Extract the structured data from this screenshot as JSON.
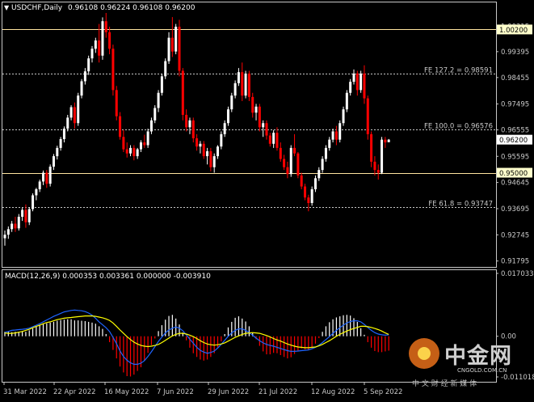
{
  "header": {
    "symbol_timeframe": "USDCHF,Daily",
    "ohlc": "0.96108 0.96224 0.96108 0.96200"
  },
  "price_axis": {
    "ticks": [
      "1.00315",
      "0.99395",
      "0.98455",
      "0.97495",
      "0.96555",
      "0.95595",
      "0.94645",
      "0.93695",
      "0.92745",
      "0.91795"
    ],
    "tick_values": [
      1.00315,
      0.99395,
      0.98455,
      0.97495,
      0.96555,
      0.95595,
      0.94645,
      0.93695,
      0.92745,
      0.91795
    ],
    "range": [
      0.9158,
      1.008
    ],
    "current_price": {
      "label": "0.96200",
      "value": 0.962
    }
  },
  "levels": [
    {
      "label": "1.00200",
      "value": 1.002,
      "style": "solid",
      "color": "#ffe4a0",
      "tagged": true
    },
    {
      "label": "0.95000",
      "value": 0.95,
      "style": "solid",
      "color": "#ffe4a0",
      "tagged": true
    },
    {
      "label": "FE 127.2 = 0.98591",
      "value": 0.98591,
      "style": "dotted",
      "color": "#c8c8c8",
      "tagged": false
    },
    {
      "label": "FE 100.0 = 0.96576",
      "value": 0.96576,
      "style": "dotted",
      "color": "#c8c8c8",
      "tagged": false
    },
    {
      "label": "FE 61.8 = 0.93747",
      "value": 0.93747,
      "style": "dotted",
      "color": "#c8c8c8",
      "tagged": false
    }
  ],
  "date_axis": [
    "31 Mar 2022",
    "22 Apr 2022",
    "16 May 2022",
    "7 Jun 2022",
    "29 Jun 2022",
    "21 Jul 2022",
    "12 Aug 2022",
    "5 Sep 2022"
  ],
  "macd": {
    "title": "MACD(12,26,9) 0.000353 0.003361 0.000000 -0.003910",
    "ticks": [
      "0.017033",
      "0.00",
      "-0.011018"
    ],
    "tick_values": [
      0.017033,
      0,
      -0.011018
    ]
  },
  "watermark": {
    "brand": "中金网",
    "domain": "CNGOLD.COM.CN",
    "slogan": "中 文 财 经 新 媒 体"
  },
  "colors": {
    "bull_candle": "#ffffff",
    "bear_candle": "#ff0000",
    "signal_line": "#ffff00",
    "macd_line": "#1e64ff",
    "level_line": "#ffe4a0",
    "tag_background": "#ffffcc"
  },
  "chart_data": {
    "type": "candlestick",
    "pair": "USDCHF",
    "timeframe": "Daily",
    "ohlc": [
      [
        0.9262,
        0.929,
        0.9235,
        0.9275
      ],
      [
        0.9275,
        0.9305,
        0.926,
        0.9295
      ],
      [
        0.9295,
        0.9325,
        0.9285,
        0.9315
      ],
      [
        0.9315,
        0.934,
        0.9285,
        0.9298
      ],
      [
        0.9298,
        0.935,
        0.929,
        0.934
      ],
      [
        0.934,
        0.9372,
        0.9325,
        0.9365
      ],
      [
        0.9365,
        0.9385,
        0.93,
        0.932
      ],
      [
        0.932,
        0.9375,
        0.931,
        0.9368
      ],
      [
        0.9368,
        0.9425,
        0.936,
        0.9418
      ],
      [
        0.9418,
        0.9445,
        0.94,
        0.944
      ],
      [
        0.944,
        0.9475,
        0.943,
        0.9468
      ],
      [
        0.9468,
        0.9508,
        0.9455,
        0.95
      ],
      [
        0.95,
        0.951,
        0.9445,
        0.946
      ],
      [
        0.946,
        0.953,
        0.945,
        0.9522
      ],
      [
        0.9522,
        0.9568,
        0.951,
        0.956
      ],
      [
        0.956,
        0.9598,
        0.9548,
        0.959
      ],
      [
        0.959,
        0.963,
        0.958,
        0.9622
      ],
      [
        0.9622,
        0.9668,
        0.961,
        0.966
      ],
      [
        0.966,
        0.971,
        0.965,
        0.97
      ],
      [
        0.97,
        0.9745,
        0.969,
        0.9738
      ],
      [
        0.9738,
        0.9755,
        0.966,
        0.968
      ],
      [
        0.968,
        0.979,
        0.967,
        0.978
      ],
      [
        0.978,
        0.984,
        0.977,
        0.9832
      ],
      [
        0.9832,
        0.988,
        0.982,
        0.9868
      ],
      [
        0.9868,
        0.9925,
        0.9855,
        0.9915
      ],
      [
        0.9915,
        0.996,
        0.99,
        0.995
      ],
      [
        0.995,
        0.999,
        0.9935,
        0.998
      ],
      [
        0.998,
        1.004,
        0.99,
        0.9925
      ],
      [
        0.9925,
        1.0064,
        0.991,
        1.005
      ],
      [
        1.005,
        1.008,
        0.999,
        1.001
      ],
      [
        1.001,
        1.003,
        0.993,
        0.995
      ],
      [
        0.995,
        0.9965,
        0.978,
        0.98
      ],
      [
        0.98,
        0.9815,
        0.969,
        0.9705
      ],
      [
        0.9705,
        0.972,
        0.962,
        0.963
      ],
      [
        0.963,
        0.9655,
        0.9575,
        0.9585
      ],
      [
        0.9585,
        0.961,
        0.9555,
        0.957
      ],
      [
        0.957,
        0.96,
        0.956,
        0.959
      ],
      [
        0.959,
        0.96,
        0.9545,
        0.956
      ],
      [
        0.956,
        0.959,
        0.955,
        0.9585
      ],
      [
        0.9585,
        0.9618,
        0.9575,
        0.961
      ],
      [
        0.961,
        0.9638,
        0.959,
        0.96
      ],
      [
        0.96,
        0.966,
        0.959,
        0.965
      ],
      [
        0.965,
        0.97,
        0.964,
        0.969
      ],
      [
        0.969,
        0.9745,
        0.968,
        0.9735
      ],
      [
        0.9735,
        0.98,
        0.972,
        0.979
      ],
      [
        0.979,
        0.986,
        0.978,
        0.985
      ],
      [
        0.985,
        0.9915,
        0.984,
        0.9905
      ],
      [
        0.9905,
        1.001,
        0.9895,
        0.999
      ],
      [
        0.999,
        1.0065,
        0.992,
        0.994
      ],
      [
        0.994,
        1.004,
        0.993,
        1.003
      ],
      [
        1.003,
        1.0055,
        0.985,
        0.987
      ],
      [
        0.987,
        0.988,
        0.969,
        0.971
      ],
      [
        0.971,
        0.973,
        0.965,
        0.9665
      ],
      [
        0.9665,
        0.97,
        0.964,
        0.969
      ],
      [
        0.969,
        0.97,
        0.961,
        0.9625
      ],
      [
        0.9625,
        0.964,
        0.958,
        0.9595
      ],
      [
        0.9595,
        0.9615,
        0.957,
        0.9605
      ],
      [
        0.9605,
        0.9615,
        0.955,
        0.956
      ],
      [
        0.956,
        0.959,
        0.953,
        0.9578
      ],
      [
        0.9578,
        0.959,
        0.9505,
        0.952
      ],
      [
        0.952,
        0.957,
        0.95,
        0.956
      ],
      [
        0.956,
        0.96,
        0.955,
        0.9595
      ],
      [
        0.9595,
        0.965,
        0.9585,
        0.964
      ],
      [
        0.964,
        0.969,
        0.963,
        0.968
      ],
      [
        0.968,
        0.974,
        0.967,
        0.973
      ],
      [
        0.973,
        0.979,
        0.972,
        0.978
      ],
      [
        0.978,
        0.9835,
        0.977,
        0.9825
      ],
      [
        0.9825,
        0.988,
        0.9815,
        0.9865
      ],
      [
        0.9865,
        0.99,
        0.976,
        0.978
      ],
      [
        0.978,
        0.987,
        0.977,
        0.986
      ],
      [
        0.986,
        0.987,
        0.976,
        0.9775
      ],
      [
        0.9775,
        0.979,
        0.97,
        0.9718
      ],
      [
        0.9718,
        0.975,
        0.969,
        0.974
      ],
      [
        0.974,
        0.975,
        0.965,
        0.9665
      ],
      [
        0.9665,
        0.969,
        0.963,
        0.968
      ],
      [
        0.968,
        0.969,
        0.962,
        0.9635
      ],
      [
        0.9635,
        0.9645,
        0.9595,
        0.9605
      ],
      [
        0.9605,
        0.9655,
        0.959,
        0.9645
      ],
      [
        0.9645,
        0.9665,
        0.958,
        0.959
      ],
      [
        0.959,
        0.961,
        0.954,
        0.955
      ],
      [
        0.955,
        0.9565,
        0.951,
        0.952
      ],
      [
        0.952,
        0.954,
        0.948,
        0.9495
      ],
      [
        0.9495,
        0.96,
        0.9485,
        0.959
      ],
      [
        0.959,
        0.964,
        0.956,
        0.957
      ],
      [
        0.957,
        0.9575,
        0.948,
        0.949
      ],
      [
        0.949,
        0.95,
        0.944,
        0.945
      ],
      [
        0.945,
        0.946,
        0.94,
        0.941
      ],
      [
        0.941,
        0.942,
        0.936,
        0.939
      ],
      [
        0.939,
        0.945,
        0.938,
        0.944
      ],
      [
        0.944,
        0.949,
        0.943,
        0.948
      ],
      [
        0.948,
        0.952,
        0.947,
        0.951
      ],
      [
        0.951,
        0.956,
        0.95,
        0.955
      ],
      [
        0.955,
        0.96,
        0.954,
        0.959
      ],
      [
        0.959,
        0.963,
        0.958,
        0.962
      ],
      [
        0.962,
        0.966,
        0.961,
        0.965
      ],
      [
        0.965,
        0.967,
        0.96,
        0.962
      ],
      [
        0.962,
        0.969,
        0.961,
        0.968
      ],
      [
        0.968,
        0.974,
        0.967,
        0.973
      ],
      [
        0.973,
        0.98,
        0.972,
        0.979
      ],
      [
        0.979,
        0.984,
        0.978,
        0.983
      ],
      [
        0.983,
        0.9875,
        0.982,
        0.986
      ],
      [
        0.986,
        0.987,
        0.978,
        0.98
      ],
      [
        0.98,
        0.987,
        0.979,
        0.986
      ],
      [
        0.986,
        0.989,
        0.975,
        0.977
      ],
      [
        0.977,
        0.978,
        0.962,
        0.964
      ],
      [
        0.964,
        0.965,
        0.952,
        0.954
      ],
      [
        0.954,
        0.956,
        0.949,
        0.951
      ],
      [
        0.951,
        0.953,
        0.9475,
        0.95
      ],
      [
        0.95,
        0.963,
        0.9495,
        0.962
      ],
      [
        0.962,
        0.963,
        0.959,
        0.961
      ],
      [
        0.96108,
        0.96224,
        0.96108,
        0.962
      ]
    ],
    "macd_histogram": [
      0.0012,
      0.0013,
      0.0011,
      0.0012,
      0.0012,
      0.0014,
      0.0012,
      0.0016,
      0.0021,
      0.0026,
      0.003,
      0.0034,
      0.0035,
      0.0037,
      0.0039,
      0.0042,
      0.0044,
      0.0045,
      0.0046,
      0.0046,
      0.0043,
      0.0043,
      0.0042,
      0.0041,
      0.0039,
      0.0037,
      0.0034,
      0.0027,
      0.002,
      0.0006,
      -0.0016,
      -0.0037,
      -0.006,
      -0.0082,
      -0.0098,
      -0.0108,
      -0.0109,
      -0.0104,
      -0.0094,
      -0.0084,
      -0.0066,
      -0.0045,
      -0.0024,
      -0.0006,
      0.0014,
      0.003,
      0.0045,
      0.0055,
      0.0058,
      0.0048,
      0.0032,
      0.001,
      -0.0011,
      -0.0031,
      -0.0046,
      -0.0056,
      -0.0063,
      -0.0066,
      -0.0063,
      -0.0056,
      -0.0046,
      -0.0031,
      -0.0014,
      0.0006,
      0.0024,
      0.0039,
      0.005,
      0.0054,
      0.0048,
      0.004,
      0.0027,
      0.001,
      -0.0008,
      -0.0026,
      -0.0041,
      -0.0049,
      -0.0049,
      -0.0045,
      -0.0046,
      -0.0051,
      -0.0056,
      -0.006,
      -0.0057,
      -0.0048,
      -0.0039,
      -0.0033,
      -0.0036,
      -0.0038,
      -0.0032,
      -0.002,
      -0.0005,
      0.0012,
      0.0027,
      0.0038,
      0.0046,
      0.0051,
      0.0054,
      0.0057,
      0.0058,
      0.0056,
      0.0049,
      0.0039,
      0.0022,
      0.0004,
      -0.0016,
      -0.0031,
      -0.004,
      -0.0043,
      -0.0043,
      -0.0041,
      -0.0039
    ],
    "macd_signal": [
      0.0009,
      0.0008,
      0.0008,
      0.0009,
      0.0011,
      0.0013,
      0.0016,
      0.0019,
      0.0023,
      0.0027,
      0.003,
      0.0034,
      0.0037,
      0.0039,
      0.0042,
      0.0045,
      0.0047,
      0.0049,
      0.005,
      0.0051,
      0.0052,
      0.0053,
      0.0054,
      0.0055,
      0.0055,
      0.0055,
      0.0054,
      0.0052,
      0.005,
      0.0047,
      0.0043,
      0.0036,
      0.0027,
      0.0017,
      0.0008,
      -0.0001,
      -0.0009,
      -0.0016,
      -0.0021,
      -0.0025,
      -0.0027,
      -0.0028,
      -0.0027,
      -0.0025,
      -0.0022,
      -0.0017,
      -0.0011,
      -0.0005,
      0.0001,
      0.0005,
      0.0008,
      0.0008,
      0.0006,
      0.0003,
      -0.0001,
      -0.0006,
      -0.0012,
      -0.0017,
      -0.0021,
      -0.0023,
      -0.0024,
      -0.0023,
      -0.0021,
      -0.0018,
      -0.0013,
      -0.0008,
      -0.0003,
      0.0001,
      0.0005,
      0.0008,
      0.0009,
      0.001,
      0.0009,
      0.0008,
      0.0005,
      0.0002,
      -0.0002,
      -0.0006,
      -0.001,
      -0.0013,
      -0.0017,
      -0.0021,
      -0.0024,
      -0.0027,
      -0.0029,
      -0.003,
      -0.0031,
      -0.0031,
      -0.003,
      -0.0029,
      -0.0026,
      -0.0022,
      -0.0017,
      -0.0012,
      -0.0006,
      0.0,
      0.0005,
      0.001,
      0.0014,
      0.0018,
      0.0021,
      0.0024,
      0.0027,
      0.0027,
      0.0026,
      0.0024,
      0.0021,
      0.0018,
      0.0014,
      0.0009,
      0.0005
    ],
    "macd_line": [
      0.0011,
      0.0013,
      0.0016,
      0.0017,
      0.0018,
      0.0019,
      0.002,
      0.0022,
      0.0026,
      0.003,
      0.0034,
      0.0039,
      0.0044,
      0.0049,
      0.0054,
      0.0058,
      0.0062,
      0.0066,
      0.0068,
      0.007,
      0.0071,
      0.007,
      0.0069,
      0.0067,
      0.0063,
      0.0057,
      0.0049,
      0.0039,
      0.0031,
      0.0023,
      0.0013,
      -0.0003,
      -0.002,
      -0.004,
      -0.0055,
      -0.0065,
      -0.0072,
      -0.0076,
      -0.0076,
      -0.0073,
      -0.0066,
      -0.0055,
      -0.0042,
      -0.0028,
      -0.0014,
      -0.0002,
      0.0009,
      0.0017,
      0.0022,
      0.0025,
      0.0022,
      0.0015,
      0.0004,
      -0.0008,
      -0.0019,
      -0.003,
      -0.0038,
      -0.0043,
      -0.0046,
      -0.0044,
      -0.004,
      -0.0032,
      -0.0022,
      -0.0011,
      0.0,
      0.0009,
      0.0016,
      0.002,
      0.002,
      0.0016,
      0.001,
      0.0003,
      -0.0005,
      -0.0012,
      -0.0018,
      -0.0022,
      -0.0025,
      -0.0027,
      -0.003,
      -0.0033,
      -0.0036,
      -0.0039,
      -0.0041,
      -0.0041,
      -0.004,
      -0.0039,
      -0.0038,
      -0.0037,
      -0.0034,
      -0.003,
      -0.0024,
      -0.0017,
      -0.0009,
      -0.0001,
      0.0008,
      0.0016,
      0.0023,
      0.003,
      0.0036,
      0.004,
      0.0042,
      0.0042,
      0.0039,
      0.0032,
      0.0024,
      0.0016,
      0.001,
      0.0006,
      0.0004,
      0.0003,
      0.0004
    ]
  }
}
